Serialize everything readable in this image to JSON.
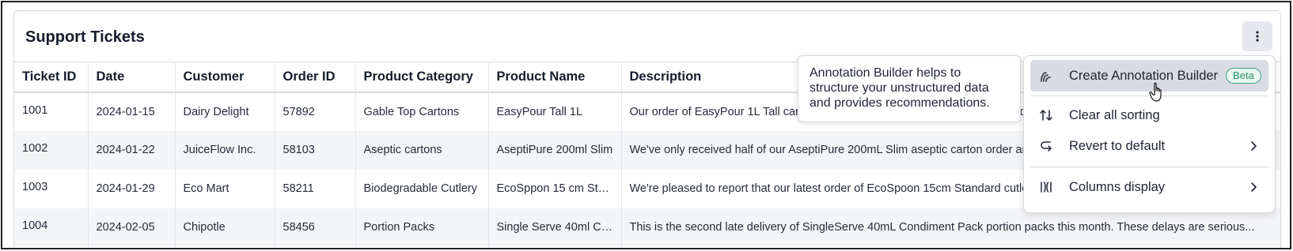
{
  "card": {
    "title": "Support Tickets"
  },
  "table": {
    "columns": [
      "Ticket ID",
      "Date",
      "Customer",
      "Order ID",
      "Product Category",
      "Product Name",
      "Description"
    ],
    "rows": [
      [
        "1001",
        "2024-01-15",
        "Dairy Delight",
        "57892",
        "Gable Top Cartons",
        "EasyPour Tall 1L",
        "Our order of EasyPour 1L Tall cartons arrived with multiple damaged units and we need a replacement shipment."
      ],
      [
        "1002",
        "2024-01-22",
        "JuiceFlow Inc.",
        "58103",
        "Aseptic cartons",
        "AseptiPure 200ml Slim",
        "We've only received half of our AseptiPure 200mL Slim aseptic carton order and need the remaining units."
      ],
      [
        "1003",
        "2024-01-29",
        "Eco Mart",
        "58211",
        "Biodegradable Cutlery",
        "EcoSppon 15 cm Stan...",
        "We're pleased to report that our latest order of EcoSpoon 15cm Standard cutlery arrived in excellent condition."
      ],
      [
        "1004",
        "2024-02-05",
        "Chipotle",
        "58456",
        "Portion Packs",
        "Single Serve 40ml Co...",
        "This is the second late delivery of SingleServe 40mL Condiment Pack portion packs this month. These delays are serious..."
      ]
    ]
  },
  "tooltip": {
    "text": "Annotation Builder helps to structure your unstructured data and provides recommendations."
  },
  "menu": {
    "create": {
      "label": "Create Annotation Builder",
      "badge": "Beta"
    },
    "clear_sort": {
      "label": "Clear all sorting"
    },
    "revert": {
      "label": "Revert to default"
    },
    "columns": {
      "label": "Columns display"
    }
  }
}
